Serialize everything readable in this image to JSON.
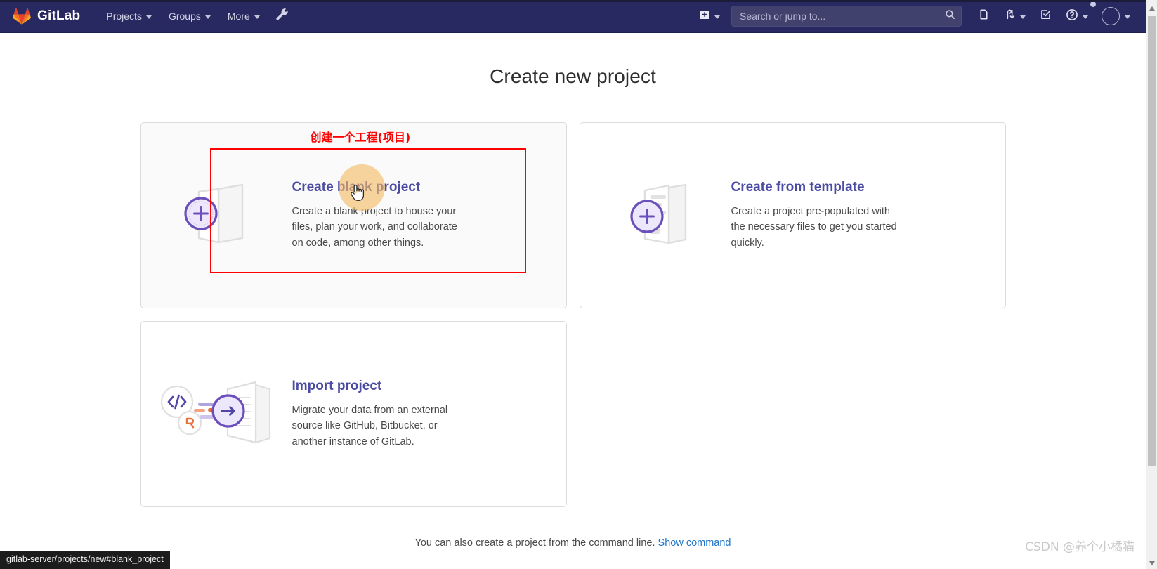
{
  "navbar": {
    "brand_name": "GitLab",
    "brand_logo_icon": "gitlab-tanuki-logo",
    "links": [
      {
        "label": "Projects",
        "icon": "chevron-down-icon"
      },
      {
        "label": "Groups",
        "icon": "chevron-down-icon"
      },
      {
        "label": "More",
        "icon": "chevron-down-icon"
      }
    ],
    "wrench_icon": "wrench-icon",
    "create_new_icon": "plus-square-icon",
    "create_new_caret_icon": "chevron-down-icon",
    "search": {
      "placeholder": "Search or jump to...",
      "value": "",
      "icon": "search-icon"
    },
    "right_icons": [
      {
        "name": "issues-icon",
        "label": "Issues"
      },
      {
        "name": "merge-requests-icon",
        "label": "Merge requests"
      },
      {
        "name": "todos-icon",
        "label": "To-Do list"
      },
      {
        "name": "help-icon",
        "label": "Help"
      }
    ],
    "avatar_icon": "user-avatar",
    "avatar_caret_icon": "chevron-down-icon"
  },
  "page": {
    "title": "Create new project"
  },
  "annotation": {
    "text": "创建一个工程(项目)",
    "color": "#fe0000"
  },
  "cards": [
    {
      "id": "create-blank-project",
      "heading": "Create blank project",
      "description": "Create a blank project to house your files, plan your work, and collaborate on code, among other things.",
      "icon": "blank-project-plus-icon",
      "hovered": true
    },
    {
      "id": "create-from-template",
      "heading": "Create from template",
      "description": "Create a project pre-populated with the necessary files to get you started quickly.",
      "icon": "template-project-plus-icon",
      "hovered": false
    },
    {
      "id": "import-project",
      "heading": "Import project",
      "description": "Migrate your data from an external source like GitHub, Bitbucket, or another instance of GitLab.",
      "icon": "import-project-arrow-icon",
      "hovered": false
    }
  ],
  "footer": {
    "note": "You can also create a project from the command line.",
    "link_label": "Show command",
    "link_color": "#1f75cb"
  },
  "status_bar": {
    "url": "gitlab-server/projects/new#blank_project"
  },
  "watermark": {
    "text": "CSDN @养个小橘猫"
  },
  "colors": {
    "navbar_bg": "#292961",
    "heading_purple": "#4b4ba3",
    "accent_purple": "#6b4fbb",
    "annotation_red": "#fe0000",
    "link_blue": "#1f75cb",
    "card_border": "#dcdcdc",
    "card_hover_bg": "#fafafa"
  }
}
